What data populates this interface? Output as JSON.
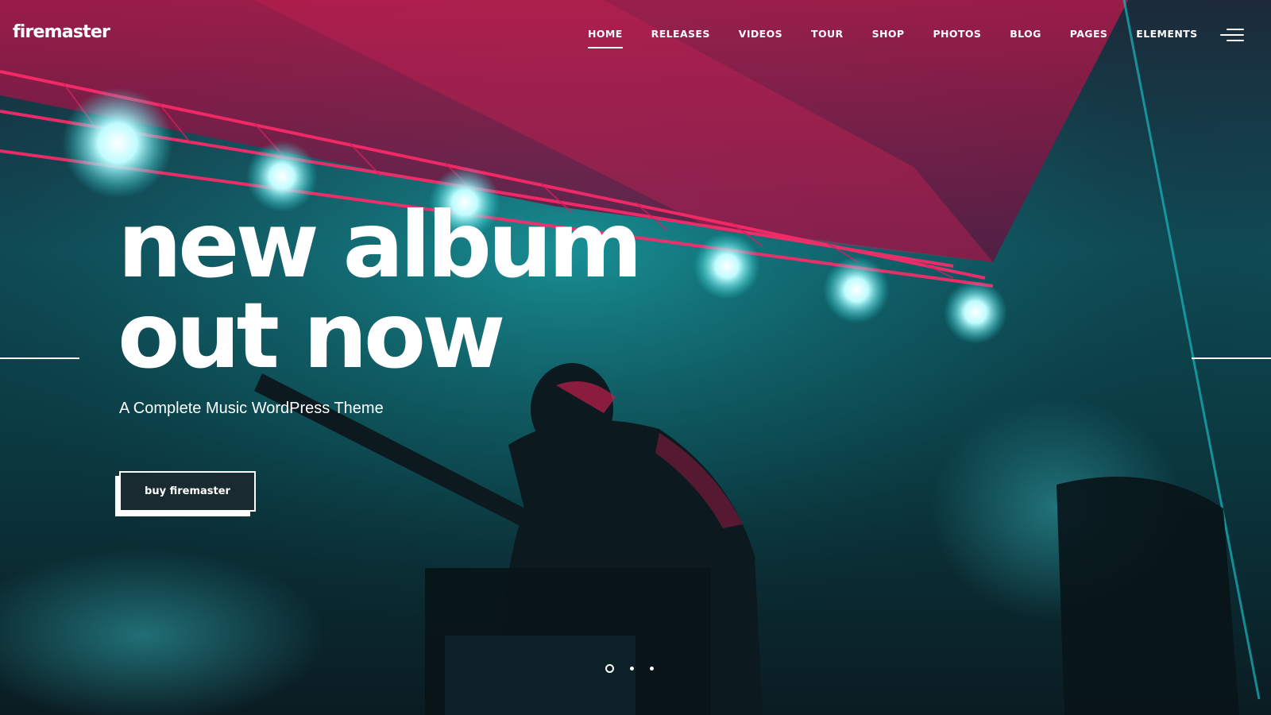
{
  "header": {
    "logo": "firemaster",
    "nav": [
      {
        "label": "HOME",
        "active": true
      },
      {
        "label": "RELEASES",
        "active": false
      },
      {
        "label": "VIDEOS",
        "active": false
      },
      {
        "label": "TOUR",
        "active": false
      },
      {
        "label": "SHOP",
        "active": false
      },
      {
        "label": "PHOTOS",
        "active": false
      },
      {
        "label": "BLOG",
        "active": false
      },
      {
        "label": "PAGES",
        "active": false
      },
      {
        "label": "ELEMENTS",
        "active": false
      }
    ],
    "menu_icon": "hamburger-menu-icon"
  },
  "hero": {
    "headline_line1": "new album",
    "headline_line2": "out now",
    "subtitle": "A Complete Music WordPress Theme",
    "cta_label": "buy firemaster",
    "background": "concert-stage-photo"
  },
  "slider": {
    "slides": 3,
    "active_index": 0
  },
  "colors": {
    "text": "#ffffff",
    "stage_teal": "#1fd8d8",
    "stage_magenta": "#e0245e",
    "background_dark": "#0d1f26"
  }
}
